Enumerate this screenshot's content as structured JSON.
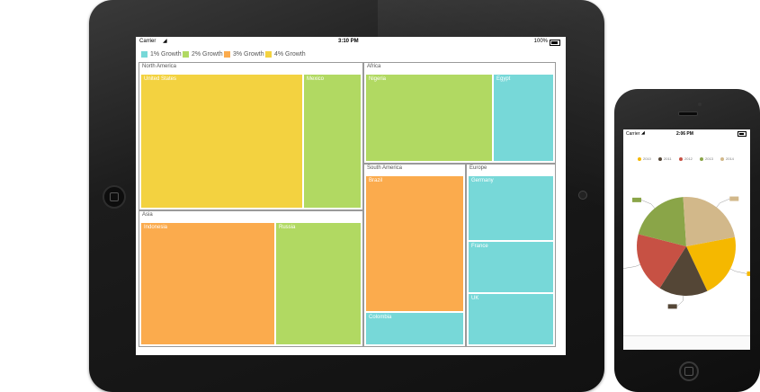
{
  "ipad": {
    "status": {
      "carrier": "Carrier",
      "time": "3:10 PM",
      "battery": "100%"
    },
    "legend": [
      {
        "label": "1% Growth",
        "color": "#77d8d8"
      },
      {
        "label": "2% Growth",
        "color": "#b1d962"
      },
      {
        "label": "3% Growth",
        "color": "#fbab4d"
      },
      {
        "label": "4% Growth",
        "color": "#f3d240"
      }
    ],
    "treemap": {
      "groups": [
        {
          "name": "North America",
          "tiles": [
            {
              "label": "United States",
              "color": "#f3d240"
            },
            {
              "label": "Mexico",
              "color": "#b1d962"
            }
          ]
        },
        {
          "name": "Africa",
          "tiles": [
            {
              "label": "Nigeria",
              "color": "#b1d962"
            },
            {
              "label": "Egypt",
              "color": "#77d8d8"
            }
          ]
        },
        {
          "name": "Asia",
          "tiles": [
            {
              "label": "Indonesia",
              "color": "#fbab4d"
            },
            {
              "label": "Russia",
              "color": "#b1d962"
            }
          ]
        },
        {
          "name": "South America",
          "tiles": [
            {
              "label": "Brazil",
              "color": "#fbab4d"
            },
            {
              "label": "Colombia",
              "color": "#77d8d8"
            }
          ]
        },
        {
          "name": "Europe",
          "tiles": [
            {
              "label": "Germany",
              "color": "#77d8d8"
            },
            {
              "label": "France",
              "color": "#77d8d8"
            },
            {
              "label": "UK",
              "color": "#77d8d8"
            }
          ]
        }
      ]
    }
  },
  "iphone": {
    "status": {
      "carrier": "Carrier",
      "time": "2:06 PM"
    },
    "legend": [
      {
        "label": "2010",
        "color": "#f5b800"
      },
      {
        "label": "2011",
        "color": "#544636"
      },
      {
        "label": "2012",
        "color": "#c75144"
      },
      {
        "label": "2013",
        "color": "#8aa548"
      },
      {
        "label": "2014",
        "color": "#d2b88a"
      }
    ],
    "pie_slice_colors": [
      "#f5b800",
      "#544636",
      "#c75144",
      "#8aa548",
      "#d2b88a"
    ]
  },
  "chart_data": {
    "type": "pie",
    "categories": [
      "2010",
      "2011",
      "2012",
      "2013",
      "2014"
    ],
    "values": [
      21,
      16,
      20,
      20,
      23
    ],
    "colors": [
      "#f5b800",
      "#544636",
      "#c75144",
      "#8aa548",
      "#d2b88a"
    ]
  }
}
